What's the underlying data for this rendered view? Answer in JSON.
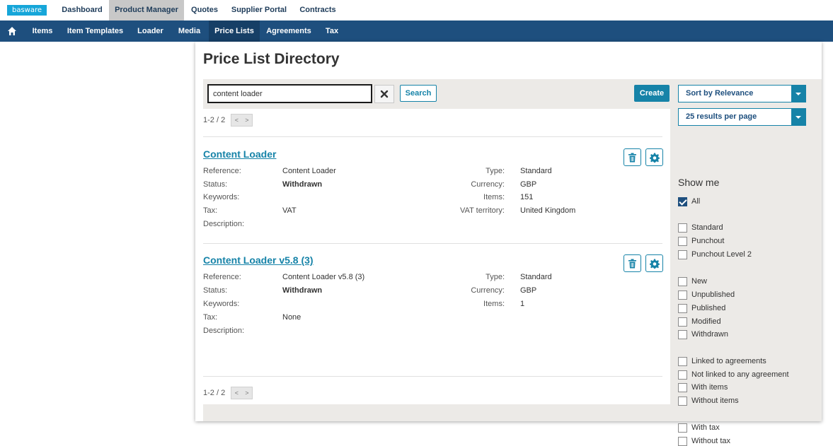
{
  "brand": {
    "logo_text": "basware"
  },
  "top_nav": [
    "Dashboard",
    "Product Manager",
    "Quotes",
    "Supplier Portal",
    "Contracts"
  ],
  "sub_nav": [
    "Items",
    "Item Templates",
    "Loader",
    "Media",
    "Price Lists",
    "Agreements",
    "Tax"
  ],
  "page_title": "Price List Directory",
  "search": {
    "value": "content loader",
    "search_label": "Search"
  },
  "create_label": "Create",
  "sort_select": "Sort by Relevance",
  "per_page_select": "25 results per page",
  "pager": {
    "text": "1-2 / 2",
    "prev": "<",
    "next": ">"
  },
  "show_me": {
    "title": "Show me",
    "all": "All",
    "group1": [
      "Standard",
      "Punchout",
      "Punchout Level 2"
    ],
    "group2": [
      "New",
      "Unpublished",
      "Published",
      "Modified",
      "Withdrawn"
    ],
    "group3": [
      "Linked to agreements",
      "Not linked to any agreement",
      "With items",
      "Without items"
    ],
    "group4": [
      "With tax",
      "Without tax"
    ]
  },
  "labels": {
    "reference": "Reference:",
    "status": "Status:",
    "keywords": "Keywords:",
    "tax": "Tax:",
    "description": "Description:",
    "type": "Type:",
    "currency": "Currency:",
    "items": "Items:",
    "vat_territory": "VAT territory:"
  },
  "results": [
    {
      "title": "Content Loader",
      "reference": "Content Loader",
      "status": "Withdrawn",
      "tax": "VAT",
      "type": "Standard",
      "currency": "GBP",
      "items": "151",
      "vat_territory": "United Kingdom"
    },
    {
      "title": "Content Loader v5.8 (3)",
      "reference": "Content Loader v5.8 (3)",
      "status": "Withdrawn",
      "tax": "None",
      "type": "Standard",
      "currency": "GBP",
      "items": "1"
    }
  ],
  "icons": {
    "home": "home-icon",
    "clear": "close-icon",
    "delete": "trash-icon",
    "settings": "gear-icon"
  },
  "colors": {
    "accent": "#1683a8",
    "nav": "#1e4f7e",
    "logo": "#16a6d9"
  }
}
